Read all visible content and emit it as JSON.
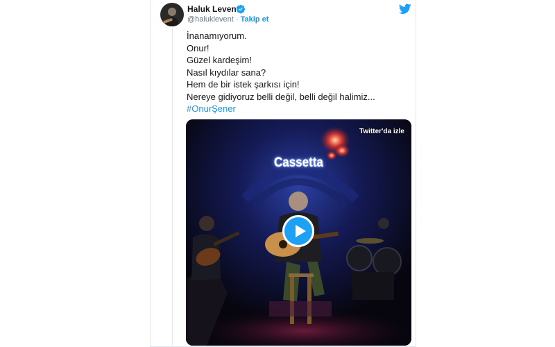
{
  "tweet": {
    "author_name": "Haluk Levent",
    "handle": "@haluklevent",
    "separator": " · ",
    "follow_label": "Takip et",
    "text_lines": [
      "İnanamıyorum.",
      "Onur!",
      "Güzel kardeşim!",
      "Nasıl kıydılar sana?",
      "Hem de bir istek şarkısı için!",
      "Nereye gidiyoruz belli değil, belli değil halimiz..."
    ],
    "hashtag": "#OnurŞener",
    "media": {
      "watch_label": "Twitter'da izle",
      "sign_text": "Cassetta"
    }
  },
  "icons": {
    "verified": "verified-badge-icon",
    "brand": "twitter-bird-icon",
    "play": "play-icon"
  },
  "colors": {
    "link": "#1b95e0",
    "text": "#14171a",
    "muted": "#657786",
    "play_button": "#1da1f2"
  }
}
